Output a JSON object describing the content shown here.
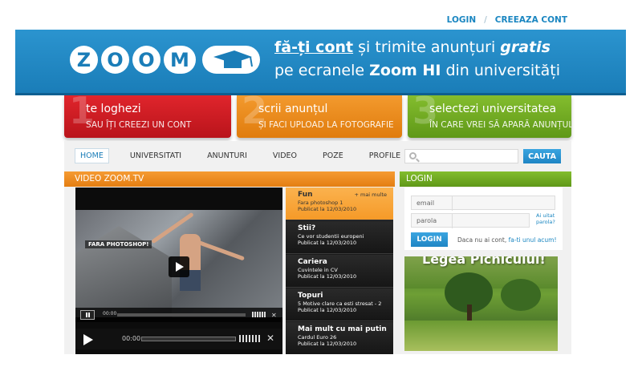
{
  "header": {
    "login_link": "LOGIN",
    "separator": "/",
    "register_link": "CREEAZA CONT"
  },
  "banner": {
    "logo_text": "ZOOM",
    "tagline_link": "fă-ți cont",
    "tagline_part1": " și trimite anunțuri ",
    "tagline_bold": "gratis",
    "tagline2_part1": "pe ecranele ",
    "tagline2_bold": "Zoom HI",
    "tagline2_part2": " din universități"
  },
  "steps": [
    {
      "number": "1",
      "title": "te loghezi",
      "subtitle": "SAU ÎȚI CREEZI UN CONT"
    },
    {
      "number": "2",
      "title": "scrii anunțul",
      "subtitle": "ȘI FACI UPLOAD LA FOTOGRAFIE"
    },
    {
      "number": "3",
      "title": "selectezi universitatea",
      "subtitle": "ÎN CARE VREI SĂ APARĂ ANUNȚUL"
    }
  ],
  "nav": {
    "items": [
      "HOME",
      "UNIVERSITATI",
      "ANUNTURI",
      "VIDEO",
      "POZE",
      "PROFILE"
    ],
    "active": "HOME"
  },
  "search": {
    "placeholder": "",
    "button_label": "CAUTA"
  },
  "video_section": {
    "header": "VIDEO ZOOM.TV",
    "overlay_label": "FARA PHOTOSHOP!",
    "time_small": "00:00",
    "time": "00:00"
  },
  "playlist": {
    "more_label": "+ mai multe",
    "items": [
      {
        "category": "Fun",
        "title": "Fara photoshop 1",
        "date": "Publicat la 12/03/2010"
      },
      {
        "category": "Stii?",
        "title": "Ce vor studentii europeni",
        "date": "Publicat la 12/03/2010"
      },
      {
        "category": "Cariera",
        "title": "Cuvintele in CV",
        "date": "Publicat la 12/03/2010"
      },
      {
        "category": "Topuri",
        "title": "5 Motive clare ca esti stresat - 2",
        "date": "Publicat la 12/03/2010"
      },
      {
        "category": "Mai mult cu mai putin",
        "title": "Cardul Euro 26",
        "date": "Publicat la 12/03/2010"
      }
    ]
  },
  "login": {
    "header": "LOGIN",
    "email_label": "email",
    "password_label": "parola",
    "forgot_line1": "Ai uitat",
    "forgot_line2": "parola?",
    "button_label": "LOGIN",
    "no_account_text": "Daca nu ai cont,",
    "register_link": "fa-ti unul acum!"
  },
  "promo": {
    "title": "Legea Picnicului!"
  },
  "colors": {
    "brand_blue": "#1a7db8",
    "red": "#d71f26",
    "orange": "#ee8a1f",
    "green": "#72ac24",
    "link": "#1a86c1"
  }
}
